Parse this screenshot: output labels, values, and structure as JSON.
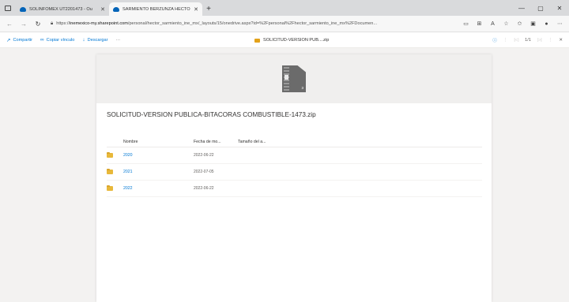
{
  "browser": {
    "tabs": [
      {
        "title": "SOLINFOMEX UT2201473 - Ou",
        "active": false
      },
      {
        "title": "SARMIENTO BERZUNZA HECTOR",
        "active": true
      }
    ],
    "address": {
      "prefix": "https://",
      "host": "inemexico-my.sharepoint.com",
      "path": "/personal/hector_sarmiento_ine_mx/_layouts/15/onedrive.aspx?id=%2Fpersonal%2Fhector_sarmiento_ine_mx%2FDocumen..."
    }
  },
  "commandbar": {
    "share": "Compartir",
    "copy_link": "Copiar vínculo",
    "download": "Descargar",
    "more": "···",
    "title": "SOLICITUD-VERSION PUB....zip",
    "page": "1/1"
  },
  "document": {
    "zip_count": "3",
    "title": "SOLICITUD-VERSION PUBLICA-BITACORAS COMBUSTIBLE-1473.zip",
    "columns": {
      "name": "Nombre",
      "date": "Fecha de mo...",
      "size": "Tamaño del a..."
    },
    "rows": [
      {
        "name": "2020",
        "date": "2022-06-22"
      },
      {
        "name": "2021",
        "date": "2022-07-05"
      },
      {
        "name": "2022",
        "date": "2022-06-22"
      }
    ]
  },
  "colors": {
    "accent": "#0078d4",
    "folder": "#e8b83a"
  }
}
